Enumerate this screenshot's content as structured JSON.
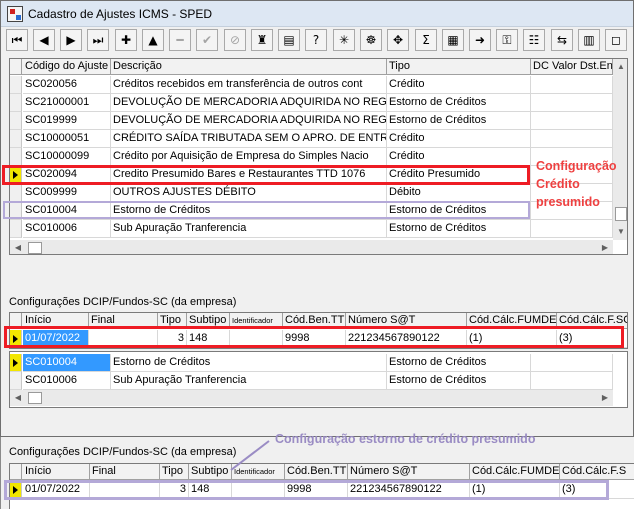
{
  "window": {
    "title": "Cadastro de Ajustes ICMS - SPED"
  },
  "toolbar": {
    "buttons": [
      {
        "glyph": "⏮",
        "icon": "first-record-icon"
      },
      {
        "glyph": "◀",
        "icon": "prior-record-icon"
      },
      {
        "glyph": "▶",
        "icon": "next-record-icon"
      },
      {
        "glyph": "⏭",
        "icon": "last-record-icon"
      },
      {
        "glyph": "✚",
        "icon": "insert-icon"
      },
      {
        "glyph": "▲",
        "icon": "edit-icon"
      },
      {
        "glyph": "━",
        "icon": "delete-icon"
      },
      {
        "glyph": "✔",
        "icon": "post-icon"
      },
      {
        "glyph": "⊘",
        "icon": "cancel-icon"
      },
      {
        "glyph": "♜",
        "icon": "stamp-icon"
      },
      {
        "glyph": "▤",
        "icon": "folder-icon"
      },
      {
        "glyph": "?",
        "icon": "help-query-icon"
      },
      {
        "glyph": "✳",
        "icon": "process-icon"
      },
      {
        "glyph": "☸",
        "icon": "tools-icon"
      },
      {
        "glyph": "✥",
        "icon": "settings-icon"
      },
      {
        "glyph": "Σ",
        "icon": "sum-icon"
      },
      {
        "glyph": "▦",
        "icon": "report-icon"
      },
      {
        "glyph": "➜",
        "icon": "export-icon"
      },
      {
        "glyph": "⚿",
        "icon": "key-icon"
      },
      {
        "glyph": "☷",
        "icon": "list-icon"
      },
      {
        "glyph": "⇆",
        "icon": "transfer-icon"
      },
      {
        "glyph": "▥",
        "icon": "calendar-icon"
      },
      {
        "glyph": "◻",
        "icon": "close-window-icon"
      }
    ]
  },
  "ajustes_grid": {
    "columns": [
      "Código do Ajuste",
      "Descrição",
      "Tipo",
      "DC Valor Dst.Ent."
    ],
    "rows": [
      {
        "codigo": "SC020056",
        "descricao": "Créditos recebidos em transferência de outros cont",
        "tipo": "Crédito"
      },
      {
        "codigo": "SC21000001",
        "descricao": "DEVOLUÇÃO DE MERCADORIA ADQUIRIDA NO REGIM",
        "tipo": "Estorno de Créditos"
      },
      {
        "codigo": "SC019999",
        "descricao": "DEVOLUÇÃO DE MERCADORIA ADQUIRIDA NO REGIM",
        "tipo": "Estorno de Créditos"
      },
      {
        "codigo": "SC10000051",
        "descricao": "CRÉDITO SAÍDA TRIBUTADA SEM O APRO. DE ENTR",
        "tipo": "Crédito"
      },
      {
        "codigo": "SC10000099",
        "descricao": "Crédito por Aquisição de Empresa do Simples Nacio",
        "tipo": "Crédito"
      },
      {
        "codigo": "SC020094",
        "descricao": "Credito Presumido Bares e Restaurantes TTD 1076",
        "tipo": "Crédito Presumido"
      },
      {
        "codigo": "SC009999",
        "descricao": "OUTROS AJUSTES DÉBITO",
        "tipo": "Débito"
      },
      {
        "codigo": "SC010004",
        "descricao": "Estorno de Créditos",
        "tipo": "Estorno de Créditos"
      },
      {
        "codigo": "SC010006",
        "descricao": "Sub Apuração Tranferencia",
        "tipo": "Estorno de Créditos"
      }
    ]
  },
  "annotation_top": {
    "line1": "Configuração",
    "line2": "Crédito",
    "line3": "presumido"
  },
  "dcip_section": {
    "label": "Configurações DCIP/Fundos-SC (da empresa)",
    "columns": [
      "Início",
      "Final",
      "Tipo",
      "Subtipo",
      "Identificador",
      "Cód.Ben.TTD",
      "Número S@T",
      "Cód.Cálc.FUMDES",
      "Cód.Cálc.F.SOC"
    ],
    "row": {
      "inicio": "01/07/2022",
      "final": "",
      "tipo": "3",
      "subtipo": "148",
      "identificador": "",
      "cod_ben_ttd": "9998",
      "numero_sat": "221234567890122",
      "cod_calc_fumdes": "(1)",
      "cod_calc_fsoc": "(3)"
    }
  },
  "sub_grid": {
    "rows": [
      {
        "codigo": "SC010004",
        "descricao": "Estorno de Créditos",
        "tipo": "Estorno de Créditos"
      },
      {
        "codigo": "SC010006",
        "descricao": "Sub Apuração Tranferencia",
        "tipo": "Estorno de Créditos"
      }
    ]
  },
  "dcip_section_2": {
    "label": "Configurações DCIP/Fundos-SC (da empresa)",
    "annotation": "Configuração estorno de crédito presumido",
    "columns": [
      "Início",
      "Final",
      "Tipo",
      "Subtipo",
      "Identificador",
      "Cód.Ben.TTD",
      "Número S@T",
      "Cód.Cálc.FUMDES",
      "Cód.Cálc.F.S"
    ],
    "row": {
      "inicio": "01/07/2022",
      "final": "",
      "tipo": "3",
      "subtipo": "148",
      "identificador": "",
      "cod_ben_ttd": "9998",
      "numero_sat": "221234567890122",
      "cod_calc_fumdes": "(1)",
      "cod_calc_fsoc": "(3)"
    }
  },
  "colors": {
    "highlight_red": "#ee1c24",
    "highlight_lavender": "#b4a9d8",
    "selection_blue": "#3399ff",
    "indicator_yellow": "#f2e600"
  }
}
